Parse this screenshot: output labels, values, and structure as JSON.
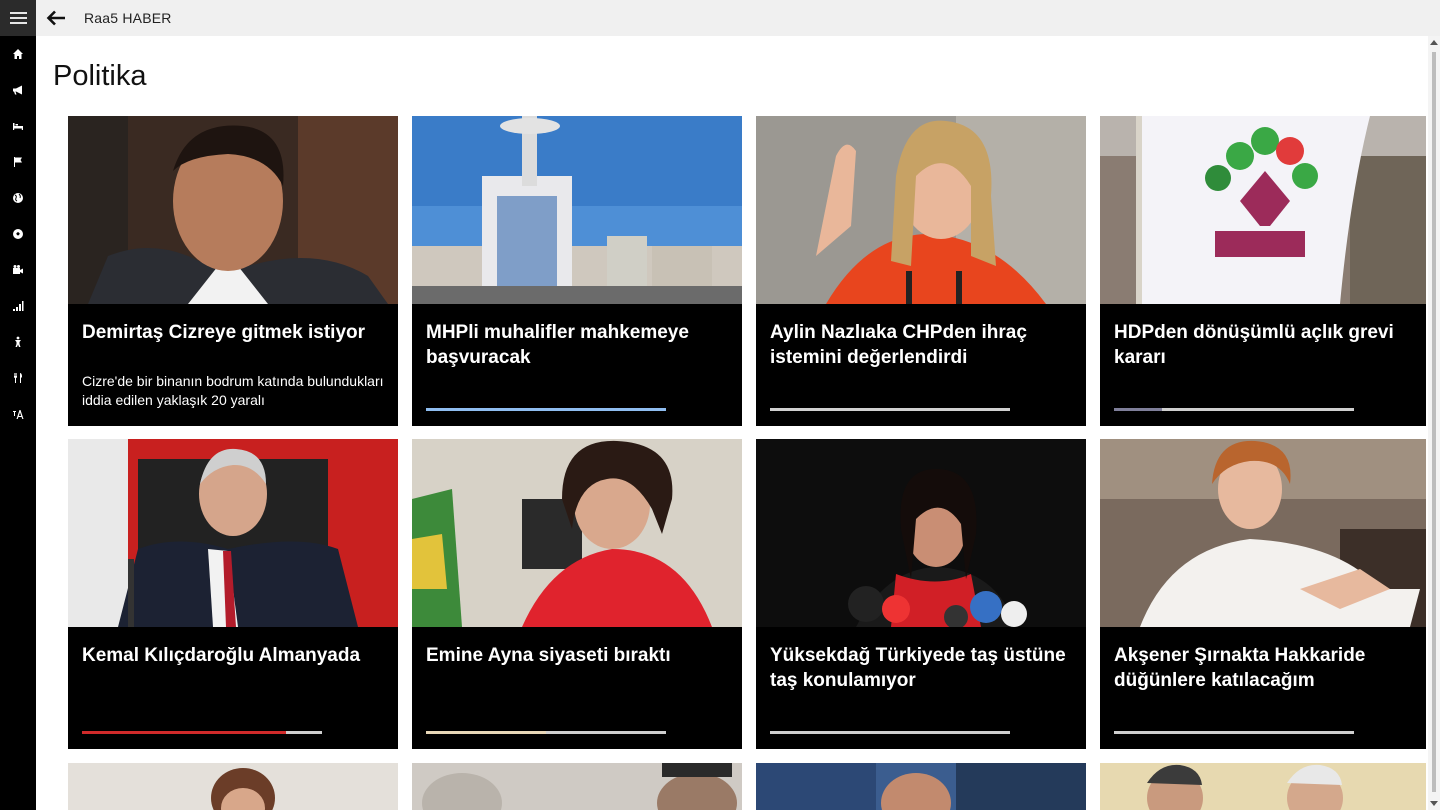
{
  "app": {
    "title": "Raa5 HABER"
  },
  "page": {
    "heading": "Politika"
  },
  "sidebar": {
    "items": [
      {
        "name": "sidebar-item-home",
        "icon": "home-icon"
      },
      {
        "name": "sidebar-item-announcements",
        "icon": "megaphone-icon"
      },
      {
        "name": "sidebar-item-bed",
        "icon": "bed-icon"
      },
      {
        "name": "sidebar-item-flag",
        "icon": "flag-icon"
      },
      {
        "name": "sidebar-item-world",
        "icon": "globe-icon"
      },
      {
        "name": "sidebar-item-sports",
        "icon": "soccer-ball-icon"
      },
      {
        "name": "sidebar-item-video",
        "icon": "camera-icon"
      },
      {
        "name": "sidebar-item-economy",
        "icon": "bar-chart-icon"
      },
      {
        "name": "sidebar-item-health",
        "icon": "figure-icon"
      },
      {
        "name": "sidebar-item-food",
        "icon": "utensils-icon"
      },
      {
        "name": "sidebar-item-language",
        "icon": "font-size-icon"
      }
    ]
  },
  "articles": [
    {
      "title": "Demirtaş Cizreye gitmek istiyor",
      "description": "Cizre'de bir binanın bodrum katında bulundukları iddia edilen yaklaşık 20 yaralı",
      "progress": 0,
      "bar_color": "#9ec6f0",
      "image": "portrait"
    },
    {
      "title": "MHPli muhalifler mahkemeye başvuracak",
      "description": "",
      "progress": 1.0,
      "bar_color": "#8fbdf0",
      "image": "building"
    },
    {
      "title": "Aylin Nazlıaka CHPden ihraç istemini değerlendirdi",
      "description": "",
      "progress": 1.0,
      "bar_color": "#d0d0d0",
      "image": "woman-red"
    },
    {
      "title": "HDPden dönüşümlü açlık grevi kararı",
      "description": "",
      "progress": 0.2,
      "bar_color": "#7f7f9a",
      "image": "flag"
    },
    {
      "title": "Kemal Kılıçdaroğlu Almanyada",
      "description": "",
      "progress": 0.85,
      "bar_color": "#d02a2a",
      "image": "man-red"
    },
    {
      "title": "Emine Ayna siyaseti bıraktı",
      "description": "",
      "progress": 0.5,
      "bar_color": "#e8d7b8",
      "image": "woman-glasses"
    },
    {
      "title": "Yüksekdağ Türkiyede taş üstüne taş konulamıyor",
      "description": "",
      "progress": 0,
      "bar_color": "#303030",
      "image": "woman-mic"
    },
    {
      "title": "Akşener Şırnakta Hakkaride düğünlere katılacağım",
      "description": "",
      "progress": 0,
      "bar_color": "#303030",
      "image": "woman-white"
    }
  ]
}
